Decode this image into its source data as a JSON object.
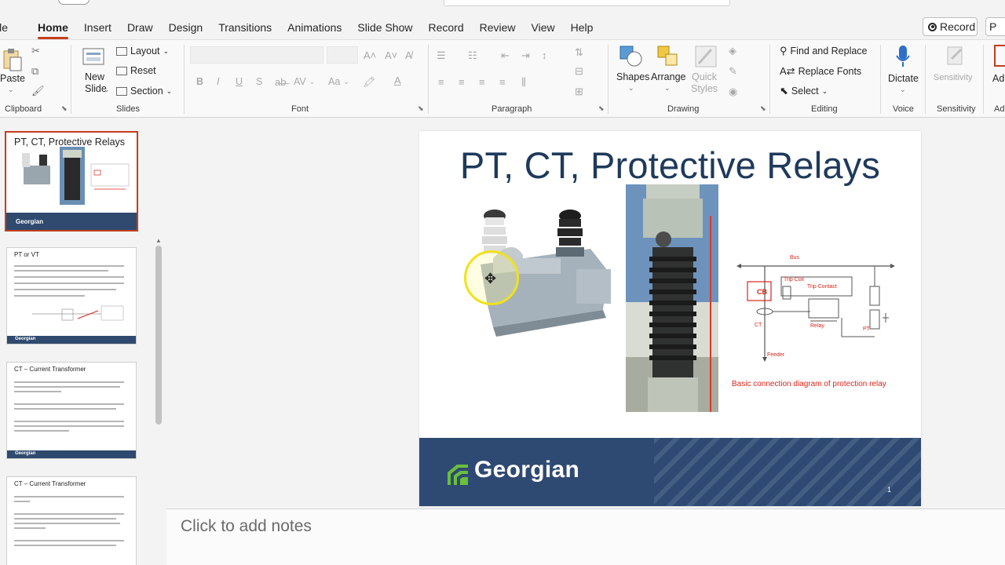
{
  "tabs": [
    "ile",
    "Home",
    "Insert",
    "Draw",
    "Design",
    "Transitions",
    "Animations",
    "Slide Show",
    "Record",
    "Review",
    "View",
    "Help"
  ],
  "record_button": "Record",
  "share_button": "P",
  "ribbon": {
    "clipboard": {
      "paste": "Paste",
      "label": "Clipboard"
    },
    "slides": {
      "new": "New",
      "slide": "Slide",
      "layout": "Layout",
      "reset": "Reset",
      "section": "Section",
      "label": "Slides"
    },
    "font": {
      "label": "Font",
      "bold": "B",
      "italic": "I",
      "underline": "U",
      "strike": "S",
      "spacing": "AV",
      "case": "Aa"
    },
    "paragraph": {
      "label": "Paragraph"
    },
    "drawing": {
      "shapes": "Shapes",
      "arrange": "Arrange",
      "quick": "Quick",
      "styles": "Styles",
      "label": "Drawing"
    },
    "editing": {
      "find_replace": "Find and Replace",
      "replace_fonts": "Replace Fonts",
      "select": "Select",
      "label": "Editing"
    },
    "voice": {
      "dictate": "Dictate",
      "label": "Voice"
    },
    "sensitivity": {
      "button": "Sensitivity",
      "label": "Sensitivity"
    },
    "addins": {
      "button": "Ad",
      "label": "Ad"
    }
  },
  "thumbnails": [
    {
      "num": "",
      "title": "PT, CT, Protective Relays",
      "footer": "Georgian"
    },
    {
      "num": "",
      "title": "PT or VT",
      "footer": "Georgian"
    },
    {
      "num": "",
      "title": "CT – Current Transformer",
      "footer": "Georgian"
    },
    {
      "num": "",
      "title": "CT – Current Transformer",
      "footer": "Georgian"
    }
  ],
  "slide": {
    "title": "PT, CT, Protective Relays",
    "diagram": {
      "bus": "Bus",
      "trip_coil": "Trip Coil",
      "trip_contact": "Trip Contact",
      "cb": "CB",
      "ct": "CT",
      "relay": "Relay",
      "pt": "PT",
      "feeder": "Feeder",
      "caption": "Basic connection diagram of protection relay"
    },
    "footer_logo": "Georgian",
    "slide_number": "1"
  },
  "notes_placeholder": "Click to add notes",
  "colors": {
    "accent": "#c43e1c",
    "title": "#1e3a5c",
    "footer": "#2f4a72",
    "logo_green": "#6abf3b",
    "diagram_red": "#d9261c"
  }
}
